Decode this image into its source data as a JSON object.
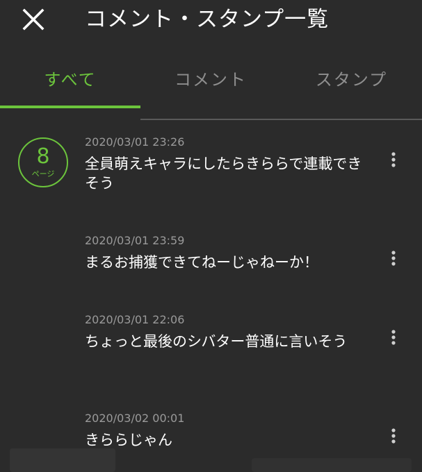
{
  "header": {
    "title": "コメント・スタンプ一覧",
    "close_icon": "close-icon"
  },
  "tabs": [
    {
      "label": "すべて",
      "active": true
    },
    {
      "label": "コメント",
      "active": false
    },
    {
      "label": "スタンプ",
      "active": false
    }
  ],
  "page": {
    "number": "8",
    "unit": "ページ"
  },
  "comments": [
    {
      "time": "2020/03/01 23:26",
      "text": "全員萌えキャラにしたらきららで連載できそう"
    },
    {
      "time": "2020/03/01 23:59",
      "text": "まるお捕獲できてねーじゃねーか！"
    },
    {
      "time": "2020/03/01 22:06",
      "text": "ちょっと最後のシバター普通に言いそう"
    },
    {
      "time": "2020/03/02 00:01",
      "text": "きららじゃん"
    }
  ],
  "colors": {
    "accent": "#6cc43c",
    "background": "#2b2b2b",
    "inactive_tab": "#8e8e8e",
    "timestamp": "#9a9a9a"
  }
}
